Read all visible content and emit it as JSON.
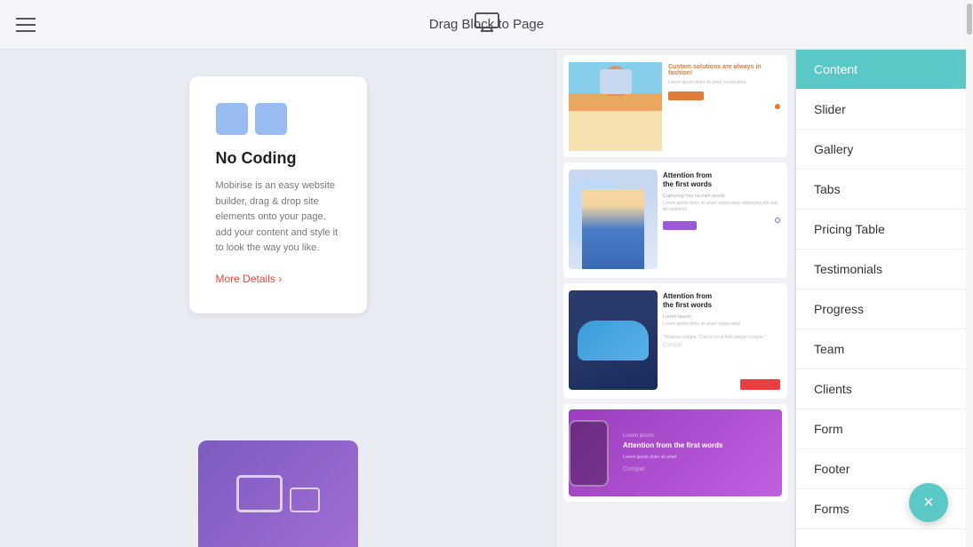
{
  "header": {
    "drag_label": "Drag Block to Page"
  },
  "left_panel": {
    "feature_card": {
      "title": "No Coding",
      "description": "Mobirise is an easy website builder, drag & drop site elements onto your page, add your content and style it to look the way you like.",
      "more_details_link": "More Details"
    },
    "bottom_icons": "layers-icon"
  },
  "right_panel": {
    "categories": [
      {
        "id": "content",
        "label": "Content",
        "active": true
      },
      {
        "id": "slider",
        "label": "Slider",
        "active": false
      },
      {
        "id": "gallery",
        "label": "Gallery",
        "active": false
      },
      {
        "id": "tabs",
        "label": "Tabs",
        "active": false
      },
      {
        "id": "pricing-table",
        "label": "Pricing Table",
        "active": false
      },
      {
        "id": "testimonials",
        "label": "Testimonials",
        "active": false
      },
      {
        "id": "progress",
        "label": "Progress",
        "active": false
      },
      {
        "id": "team",
        "label": "Team",
        "active": false
      },
      {
        "id": "clients",
        "label": "Clients",
        "active": false
      },
      {
        "id": "form",
        "label": "Form",
        "active": false
      },
      {
        "id": "footer",
        "label": "Footer",
        "active": false
      },
      {
        "id": "forms",
        "label": "Forms",
        "active": false
      }
    ]
  },
  "close_button": {
    "label": "×"
  },
  "icons": {
    "hamburger": "☰",
    "monitor": "🖥",
    "close": "×",
    "arrow": "›"
  }
}
